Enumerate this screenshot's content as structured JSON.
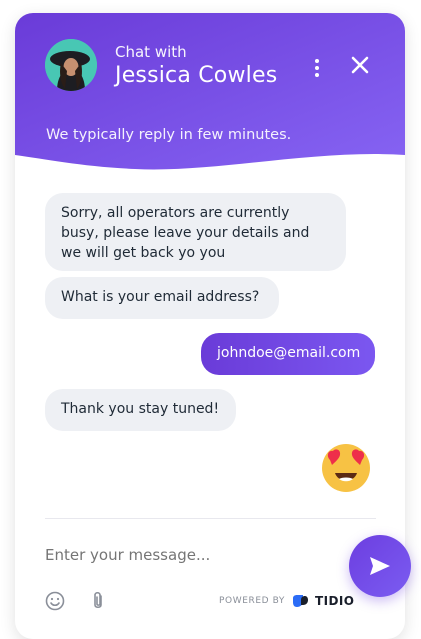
{
  "header": {
    "eyebrow": "Chat with",
    "agent_name": "Jessica Cowles",
    "subtitle": "We typically reply in few minutes.",
    "menu_icon": "more-vertical-icon",
    "close_icon": "close-icon"
  },
  "messages": [
    {
      "from": "operator",
      "text": "Sorry, all operators are currently busy, please leave your details and we will get back yo you"
    },
    {
      "from": "operator",
      "text": "What is your email address?"
    },
    {
      "from": "visitor",
      "text": "johndoe@email.com"
    },
    {
      "from": "operator",
      "text": "Thank you stay tuned!"
    },
    {
      "from": "visitor",
      "emoji": "heart-eyes-emoji"
    }
  ],
  "composer": {
    "placeholder": "Enter your message...",
    "emoji_icon": "smile-icon",
    "attach_icon": "paperclip-icon",
    "send_icon": "send-icon"
  },
  "footer": {
    "powered_by": "POWERED BY",
    "brand": "TIDIO"
  },
  "colors": {
    "accent_start": "#6a3bd8",
    "accent_end": "#7b57f0",
    "operator_bubble": "#eef0f4"
  }
}
